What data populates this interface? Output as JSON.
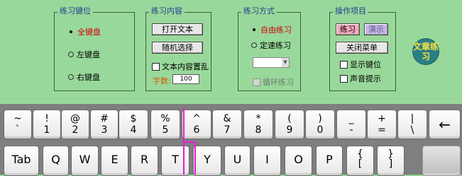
{
  "groups": {
    "key_positions": {
      "title": "练习键位",
      "options": [
        "全键盘",
        "左键盘",
        "右键盘"
      ]
    },
    "content": {
      "title": "练习内容",
      "open_text": "打开文本",
      "random_select": "随机选择",
      "shuffle": "文本内容置乱",
      "count_label": "字数:",
      "count_value": "100"
    },
    "mode": {
      "title": "练习方式",
      "free": "自由练习",
      "timed": "定速练习",
      "loop": "循环练习"
    },
    "ops": {
      "title": "操作项目",
      "practice": "练习",
      "demo": "演示",
      "close_menu": "关闭菜单",
      "show_keys": "显示键位",
      "sound": "声音提示"
    }
  },
  "badge": "文章练习",
  "keyboard": {
    "row1": [
      {
        "top": "~",
        "bot": "`"
      },
      {
        "top": "!",
        "bot": "1"
      },
      {
        "top": "@",
        "bot": "2"
      },
      {
        "top": "#",
        "bot": "3"
      },
      {
        "top": "$",
        "bot": "4"
      },
      {
        "top": "%",
        "bot": "5"
      },
      {
        "top": "^",
        "bot": "6"
      },
      {
        "top": "&",
        "bot": "7"
      },
      {
        "top": "*",
        "bot": "8"
      },
      {
        "top": "(",
        "bot": "9"
      },
      {
        "top": ")",
        "bot": "0"
      },
      {
        "top": "_",
        "bot": "-"
      },
      {
        "top": "+",
        "bot": "="
      },
      {
        "top": "|",
        "bot": "\\"
      },
      {
        "top": "←",
        "bot": ""
      }
    ],
    "row2": [
      {
        "top": "Tab",
        "bot": ""
      },
      {
        "top": "Q",
        "bot": ""
      },
      {
        "top": "W",
        "bot": ""
      },
      {
        "top": "E",
        "bot": ""
      },
      {
        "top": "R",
        "bot": ""
      },
      {
        "top": "T",
        "bot": ""
      },
      {
        "top": "Y",
        "bot": ""
      },
      {
        "top": "U",
        "bot": ""
      },
      {
        "top": "I",
        "bot": ""
      },
      {
        "top": "O",
        "bot": ""
      },
      {
        "top": "P",
        "bot": ""
      },
      {
        "top": "{",
        "bot": "["
      },
      {
        "top": "}",
        "bot": "]"
      },
      {
        "top": "",
        "bot": ""
      }
    ]
  }
}
